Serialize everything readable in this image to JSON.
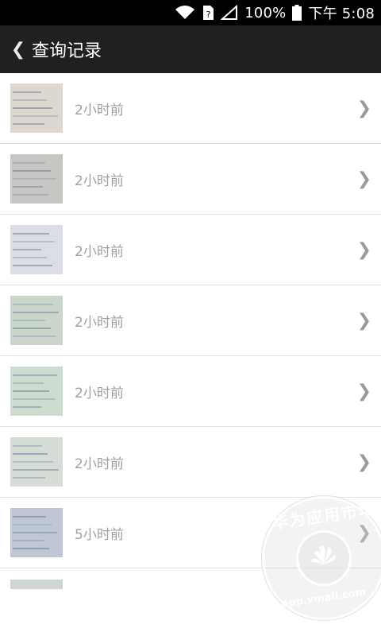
{
  "status_bar": {
    "battery": "100%",
    "time": "下午 5:08",
    "icons": [
      "wifi-icon",
      "sim-icon",
      "signal-icon",
      "battery-icon"
    ]
  },
  "header": {
    "title": "查询记录",
    "back_icon": "chevron-left-icon"
  },
  "records": [
    {
      "time": "2小时前",
      "thumb_tone": "#dcd8d0"
    },
    {
      "time": "2小时前",
      "thumb_tone": "#c8c6c2"
    },
    {
      "time": "2小时前",
      "thumb_tone": "#dadde4"
    },
    {
      "time": "2小时前",
      "thumb_tone": "#c9d6c9"
    },
    {
      "time": "2小时前",
      "thumb_tone": "#cddccf"
    },
    {
      "time": "2小时前",
      "thumb_tone": "#d6dcd6"
    },
    {
      "time": "5小时前",
      "thumb_tone": "#bfc7d6"
    }
  ],
  "partial_record": {
    "thumb_tone": "#cfd6cf"
  },
  "watermark": {
    "top_text": "华为应用市场",
    "bottom_text": "app.vmall.com"
  }
}
